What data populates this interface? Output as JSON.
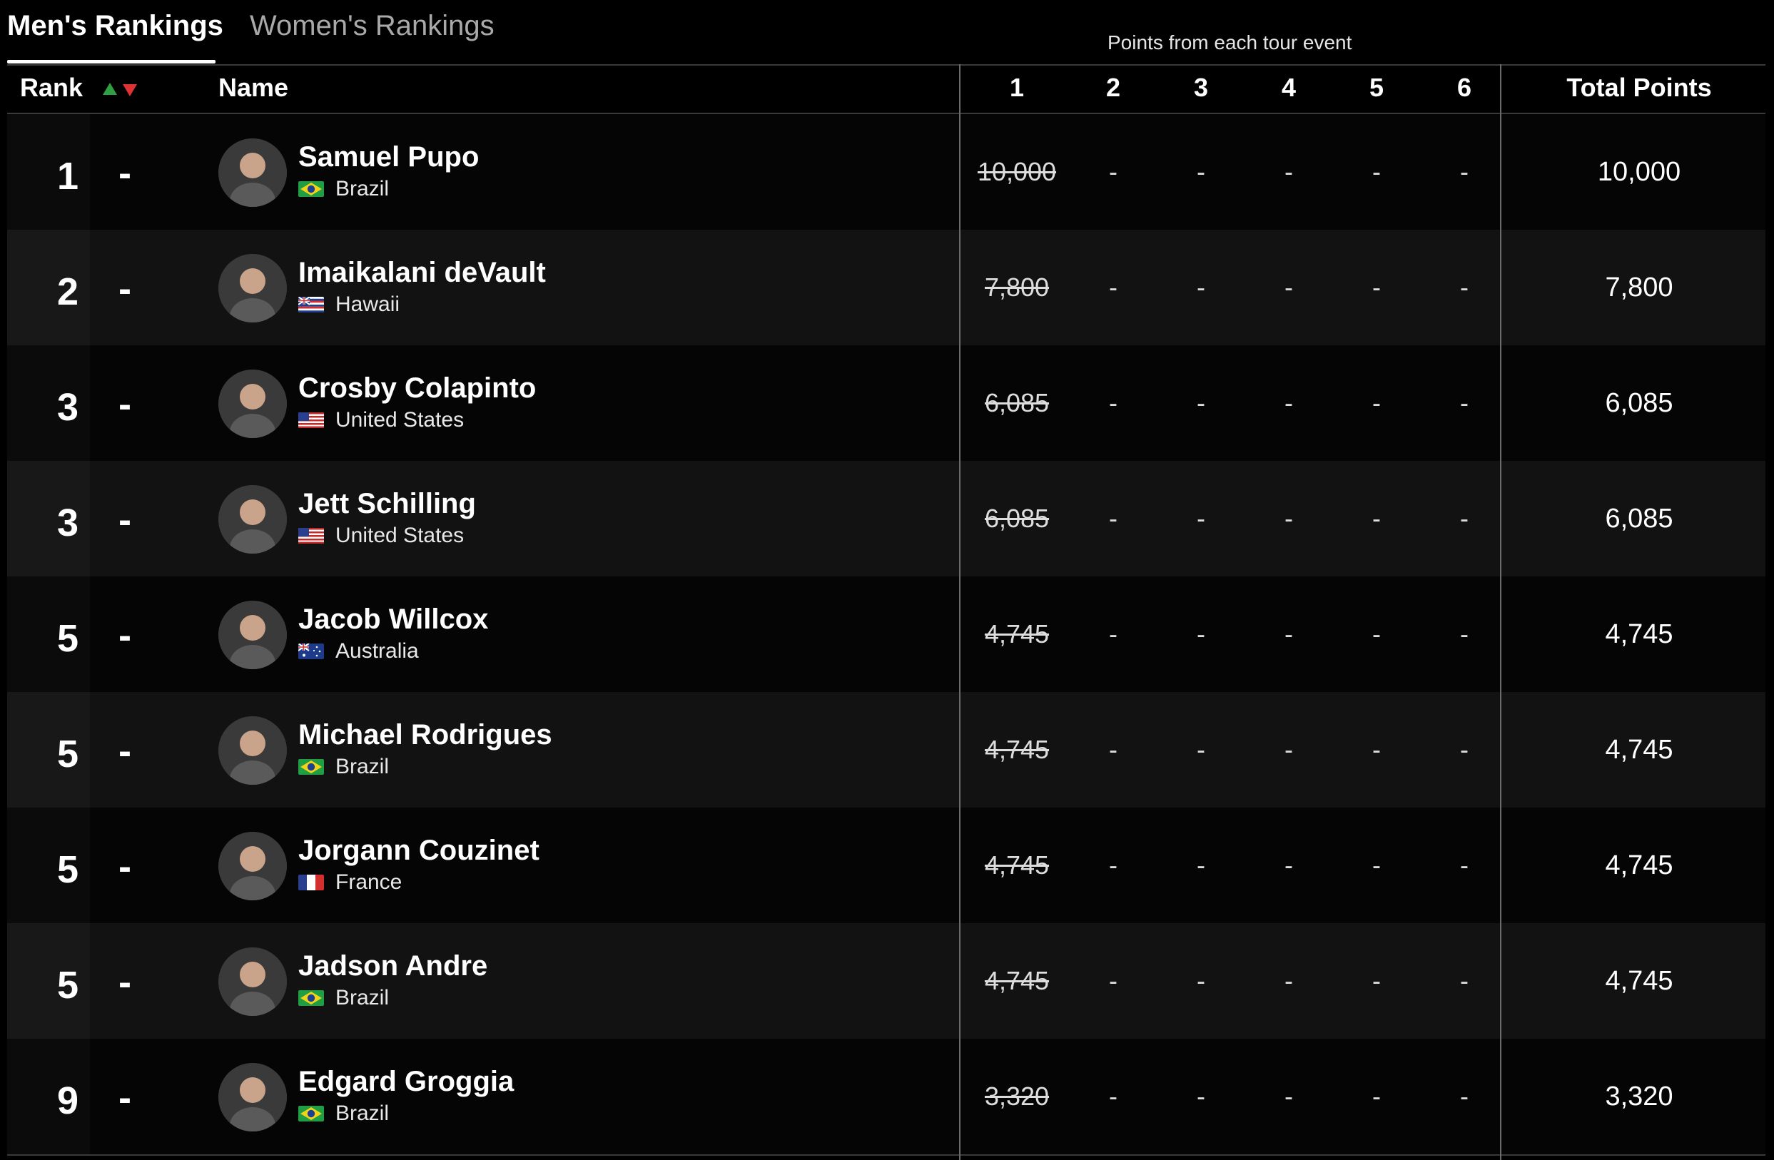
{
  "tabs": {
    "men": "Men's Rankings",
    "women": "Women's Rankings"
  },
  "caption": "Points from each tour event",
  "header": {
    "rank": "Rank",
    "name": "Name",
    "events": [
      "1",
      "2",
      "3",
      "4",
      "5",
      "6"
    ],
    "total": "Total Points"
  },
  "colors": {
    "up": "#2ea043",
    "down": "#dd3333"
  },
  "rows": [
    {
      "rank": "1",
      "move": "-",
      "name": "Samuel Pupo",
      "country": "Brazil",
      "flag": "brazil-flag-icon",
      "event1": "10,000",
      "events": [
        "-",
        "-",
        "-",
        "-",
        "-"
      ],
      "total": "10,000"
    },
    {
      "rank": "2",
      "move": "-",
      "name": "Imaikalani deVault",
      "country": "Hawaii",
      "flag": "hawaii-flag-icon",
      "event1": "7,800",
      "events": [
        "-",
        "-",
        "-",
        "-",
        "-"
      ],
      "total": "7,800"
    },
    {
      "rank": "3",
      "move": "-",
      "name": "Crosby Colapinto",
      "country": "United States",
      "flag": "usa-flag-icon",
      "event1": "6,085",
      "events": [
        "-",
        "-",
        "-",
        "-",
        "-"
      ],
      "total": "6,085"
    },
    {
      "rank": "3",
      "move": "-",
      "name": "Jett Schilling",
      "country": "United States",
      "flag": "usa-flag-icon",
      "event1": "6,085",
      "events": [
        "-",
        "-",
        "-",
        "-",
        "-"
      ],
      "total": "6,085"
    },
    {
      "rank": "5",
      "move": "-",
      "name": "Jacob Willcox",
      "country": "Australia",
      "flag": "australia-flag-icon",
      "event1": "4,745",
      "events": [
        "-",
        "-",
        "-",
        "-",
        "-"
      ],
      "total": "4,745"
    },
    {
      "rank": "5",
      "move": "-",
      "name": "Michael Rodrigues",
      "country": "Brazil",
      "flag": "brazil-flag-icon",
      "event1": "4,745",
      "events": [
        "-",
        "-",
        "-",
        "-",
        "-"
      ],
      "total": "4,745"
    },
    {
      "rank": "5",
      "move": "-",
      "name": "Jorgann Couzinet",
      "country": "France",
      "flag": "france-flag-icon",
      "event1": "4,745",
      "events": [
        "-",
        "-",
        "-",
        "-",
        "-"
      ],
      "total": "4,745"
    },
    {
      "rank": "5",
      "move": "-",
      "name": "Jadson Andre",
      "country": "Brazil",
      "flag": "brazil-flag-icon",
      "event1": "4,745",
      "events": [
        "-",
        "-",
        "-",
        "-",
        "-"
      ],
      "total": "4,745"
    },
    {
      "rank": "9",
      "move": "-",
      "name": "Edgard Groggia",
      "country": "Brazil",
      "flag": "brazil-flag-icon",
      "event1": "3,320",
      "events": [
        "-",
        "-",
        "-",
        "-",
        "-"
      ],
      "total": "3,320"
    }
  ]
}
